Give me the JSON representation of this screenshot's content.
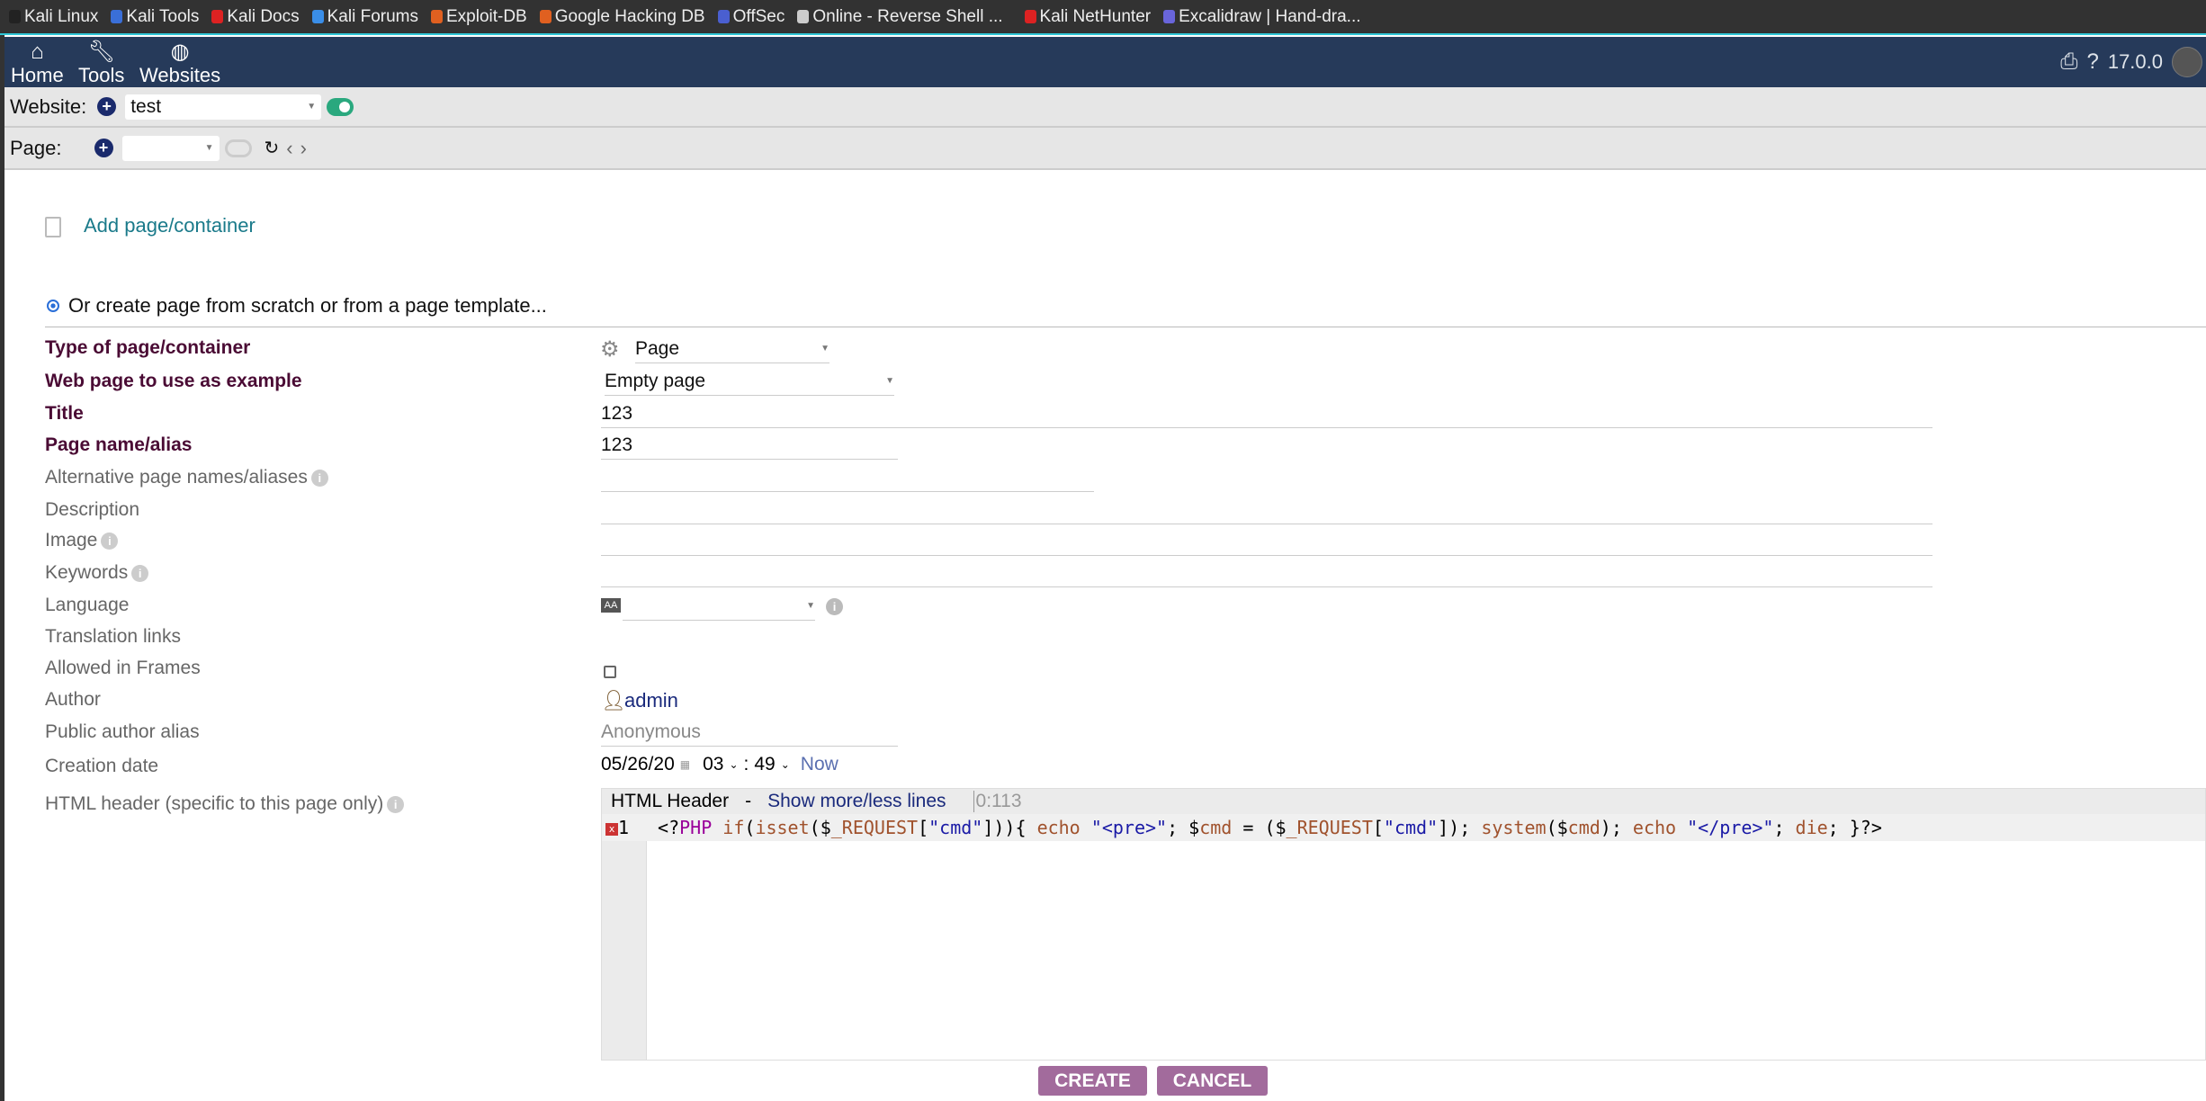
{
  "bookmarks": [
    {
      "label": "Kali Linux",
      "color": "#222"
    },
    {
      "label": "Kali Tools",
      "color": "#3a6fd8"
    },
    {
      "label": "Kali Docs",
      "color": "#d22"
    },
    {
      "label": "Kali Forums",
      "color": "#3a8ee8"
    },
    {
      "label": "Exploit-DB",
      "color": "#e06020"
    },
    {
      "label": "Google Hacking DB",
      "color": "#e06020"
    },
    {
      "label": "OffSec",
      "color": "#4a5fd0"
    },
    {
      "label": "Online - Reverse Shell ...",
      "color": "#ccc"
    },
    {
      "label": "Kali NetHunter",
      "color": "#d22"
    },
    {
      "label": "Excalidraw | Hand-dra...",
      "color": "#6965db"
    }
  ],
  "nav": {
    "items": [
      {
        "label": "Home",
        "icon": "home-icon"
      },
      {
        "label": "Tools",
        "icon": "wrench-icon"
      },
      {
        "label": "Websites",
        "icon": "globe-icon"
      }
    ],
    "version": "17.0.0"
  },
  "website_bar": {
    "label": "Website:",
    "selected": "test",
    "enabled": true
  },
  "page_bar": {
    "label": "Page:",
    "selected": "",
    "enabled": false
  },
  "add_page": "Add page/container",
  "create_option": "Or create page from scratch or from a page template...",
  "form": {
    "type_label": "Type of page/container",
    "type_value": "Page",
    "example_label": "Web page to use as example",
    "example_value": "Empty page",
    "title_label": "Title",
    "title_value": "123",
    "alias_label": "Page name/alias",
    "alias_value": "123",
    "alt_label": "Alternative page names/aliases",
    "desc_label": "Description",
    "image_label": "Image",
    "keywords_label": "Keywords",
    "language_label": "Language",
    "language_value": "",
    "translation_label": "Translation links",
    "frames_label": "Allowed in Frames",
    "frames_checked": false,
    "author_label": "Author",
    "author_value": "admin",
    "public_alias_label": "Public author alias",
    "public_alias_placeholder": "Anonymous",
    "date_label": "Creation date",
    "date_value": "05/26/20",
    "hour": "03",
    "minute": "49",
    "now": "Now",
    "header_label": "HTML header (specific to this page only)"
  },
  "editor": {
    "title": "HTML Header",
    "sep": "-",
    "toggle": "Show more/less lines",
    "position": "0:113",
    "line_number": "1"
  },
  "buttons": {
    "create": "CREATE",
    "cancel": "CANCEL"
  },
  "colors": {
    "nav": "#263a5a",
    "accent": "#a26b9c",
    "label": "#4a0b34",
    "link": "#1a7a8a"
  }
}
